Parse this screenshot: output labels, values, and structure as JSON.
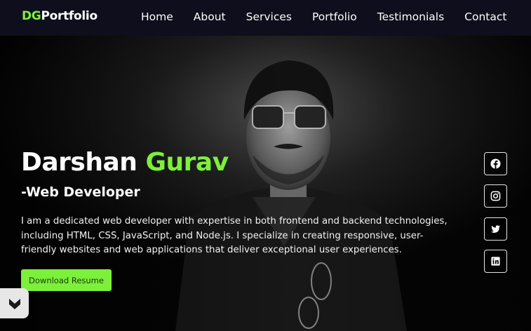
{
  "nav": {
    "logo_accent": "DG",
    "logo_rest": "Portfolio",
    "links": [
      "Home",
      "About",
      "Services",
      "Portfolio",
      "Testimonials",
      "Contact"
    ]
  },
  "hero": {
    "first_name": "Darshan",
    "last_name": "Gurav",
    "role": "-Web Developer",
    "bio": "I am a dedicated web developer with expertise in both frontend and backend technologies, including HTML, CSS, JavaScript, and Node.js. I specialize in creating responsive, user-friendly websites and web applications that deliver exceptional user experiences.",
    "cta_label": "Download Resume"
  },
  "social": [
    "facebook-icon",
    "instagram-icon",
    "twitter-icon",
    "linkedin-icon"
  ],
  "colors": {
    "accent": "#7cf03a",
    "nav_bg": "#0e0e1c",
    "hero_bg": "#050508"
  }
}
